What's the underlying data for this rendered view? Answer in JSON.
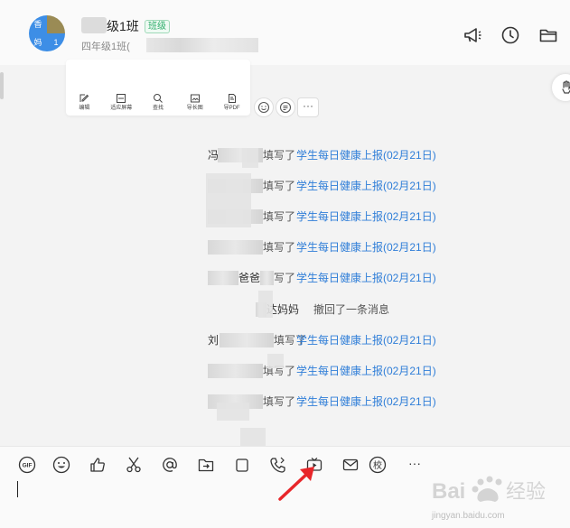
{
  "header": {
    "title": "级1班",
    "badge": "班级",
    "subtitle": "四年级1班(",
    "avatar": {
      "q1": "香",
      "q2": "",
      "q3": "妈",
      "q4": "1"
    },
    "icons": [
      "megaphone-icon",
      "clock-icon",
      "folder-icon"
    ]
  },
  "doc_toolbar": {
    "items": [
      {
        "label": "编辑",
        "icon": "edit-icon"
      },
      {
        "label": "适应屏幕",
        "icon": "fit-screen-icon"
      },
      {
        "label": "查找",
        "icon": "search-icon"
      },
      {
        "label": "导长图",
        "icon": "export-image-icon"
      },
      {
        "label": "导PDF",
        "icon": "export-pdf-icon"
      }
    ],
    "more": "···"
  },
  "messages": [
    {
      "prefix": "冯",
      "action": "填写了",
      "link": "学生每日健康上报(02月21日)"
    },
    {
      "prefix": "",
      "action": "填写了",
      "link": "学生每日健康上报(02月21日)"
    },
    {
      "prefix": "",
      "action": "填写了",
      "link": "学生每日健康上报(02月21日)"
    },
    {
      "prefix": "",
      "action": "填写了",
      "link": "学生每日健康上报(02月21日)"
    },
    {
      "prefix": "爸爸",
      "action": "写了",
      "link": "学生每日健康上报(02月21日)"
    },
    {
      "prefix": "达妈妈",
      "action": "撤回了一条消息",
      "link": ""
    },
    {
      "prefix": "刘",
      "action": "填写了",
      "link": "学生每日健康上报(02月21日)"
    },
    {
      "prefix": "",
      "action": "填写了",
      "link": "学生每日健康上报(02月21日)"
    },
    {
      "prefix": "",
      "action": "填写了",
      "link": "学生每日健康上报(02月21日)"
    }
  ],
  "input_toolbar": {
    "gif_label": "GIF",
    "check_label": "校",
    "more_label": "···",
    "icons": [
      "gif-icon",
      "emoji-icon",
      "thumbs-up-icon",
      "scissors-icon",
      "at-icon",
      "folder-send-icon",
      "clip-icon",
      "phone-icon",
      "live-video-icon",
      "mail-icon",
      "check-mark-icon",
      "more-icon"
    ]
  },
  "watermark": {
    "text": "jingyan.baidu.com"
  },
  "colors": {
    "link": "#2f7ed8",
    "badge": "#2fae6b",
    "annotation_arrow": "#e8262a"
  }
}
